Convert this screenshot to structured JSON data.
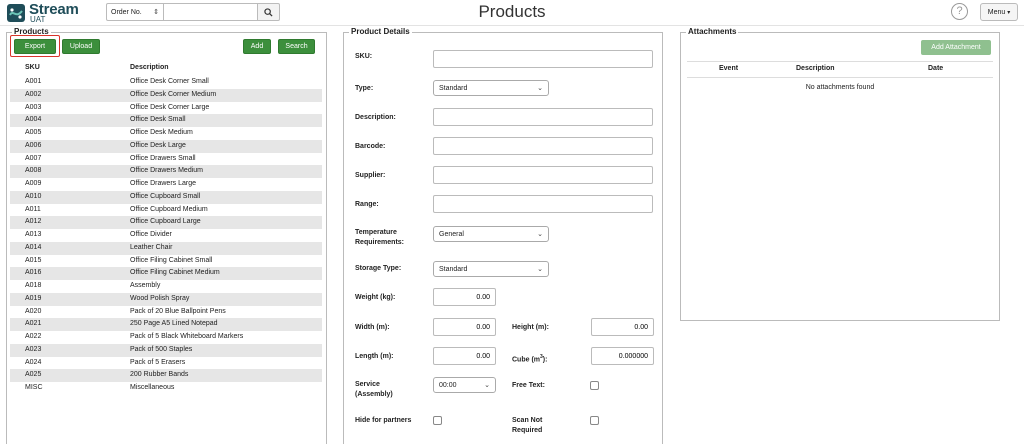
{
  "header": {
    "logo_title": "Stream",
    "logo_sub": "UAT",
    "search_type": "Order No.",
    "search_value": "",
    "page_title": "Products",
    "help_glyph": "?",
    "menu_label": "Menu"
  },
  "products": {
    "title": "Products",
    "buttons": {
      "export": "Export",
      "upload": "Upload",
      "add": "Add",
      "search": "Search"
    },
    "columns": {
      "sku": "SKU",
      "description": "Description"
    },
    "rows": [
      {
        "sku": "A001",
        "description": "Office Desk Corner Small"
      },
      {
        "sku": "A002",
        "description": "Office Desk Corner Medium"
      },
      {
        "sku": "A003",
        "description": "Office Desk Corner Large"
      },
      {
        "sku": "A004",
        "description": "Office Desk Small"
      },
      {
        "sku": "A005",
        "description": "Office Desk Medium"
      },
      {
        "sku": "A006",
        "description": "Office Desk Large"
      },
      {
        "sku": "A007",
        "description": "Office Drawers Small"
      },
      {
        "sku": "A008",
        "description": "Office Drawers Medium"
      },
      {
        "sku": "A009",
        "description": "Office Drawers Large"
      },
      {
        "sku": "A010",
        "description": "Office Cupboard Small"
      },
      {
        "sku": "A011",
        "description": "Office Cupboard Medium"
      },
      {
        "sku": "A012",
        "description": "Office Cupboard Large"
      },
      {
        "sku": "A013",
        "description": "Office Divider"
      },
      {
        "sku": "A014",
        "description": "Leather Chair"
      },
      {
        "sku": "A015",
        "description": "Office Filing Cabinet Small"
      },
      {
        "sku": "A016",
        "description": "Office Filing Cabinet Medium"
      },
      {
        "sku": "A018",
        "description": "Assembly"
      },
      {
        "sku": "A019",
        "description": "Wood Polish Spray"
      },
      {
        "sku": "A020",
        "description": "Pack of 20 Blue Ballpoint Pens"
      },
      {
        "sku": "A021",
        "description": "250 Page A5 Lined Notepad"
      },
      {
        "sku": "A022",
        "description": "Pack of 5 Black Whiteboard Markers"
      },
      {
        "sku": "A023",
        "description": "Pack of 500 Staples"
      },
      {
        "sku": "A024",
        "description": "Pack of 5 Erasers"
      },
      {
        "sku": "A025",
        "description": "200 Rubber Bands"
      },
      {
        "sku": "MISC",
        "description": "Miscellaneous"
      }
    ]
  },
  "details": {
    "title": "Product Details",
    "labels": {
      "sku": "SKU:",
      "type": "Type:",
      "description": "Description:",
      "barcode": "Barcode:",
      "supplier": "Supplier:",
      "range": "Range:",
      "temperature_1": "Temperature",
      "temperature_2": "Requirements:",
      "storage_type": "Storage Type:",
      "weight": "Weight (kg):",
      "width": "Width (m):",
      "height": "Height (m):",
      "length": "Length (m):",
      "cube_prefix": "Cube (m",
      "cube_sup": "3",
      "cube_suffix": "):",
      "service_1": "Service",
      "service_2": "(Assembly)",
      "free_text": "Free Text:",
      "hide_partners": "Hide for partners",
      "scan_1": "Scan Not",
      "scan_2": "Required"
    },
    "values": {
      "sku": "",
      "type": "Standard",
      "description": "",
      "barcode": "",
      "supplier": "",
      "range": "",
      "temperature": "General",
      "storage_type": "Standard",
      "weight": "0.00",
      "width": "0.00",
      "height": "0.00",
      "length": "0.00",
      "cube": "0.000000",
      "service": "00:00"
    }
  },
  "attachments": {
    "title": "Attachments",
    "add_label": "Add Attachment",
    "columns": {
      "event": "Event",
      "description": "Description",
      "date": "Date"
    },
    "empty_message": "No attachments found"
  }
}
